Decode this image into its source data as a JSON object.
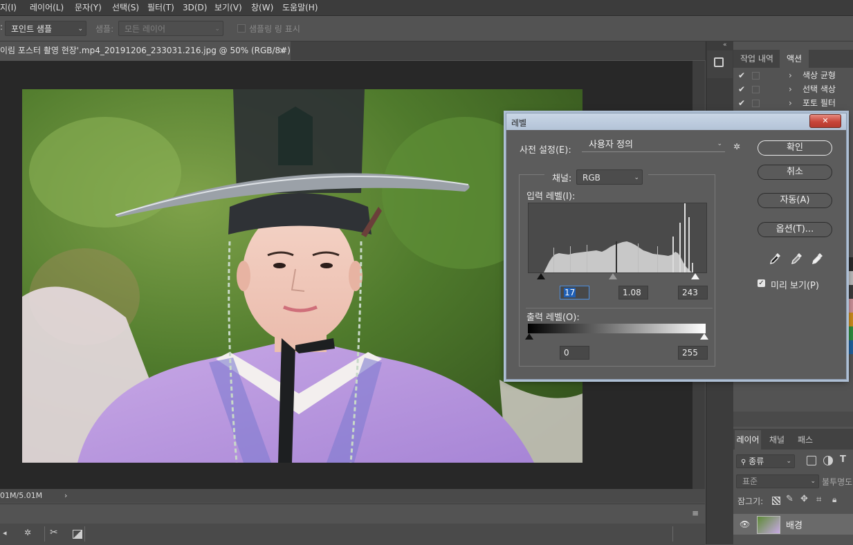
{
  "menu": [
    "지(I)",
    "레이어(L)",
    "문자(Y)",
    "선택(S)",
    "필터(T)",
    "3D(D)",
    "보기(V)",
    "창(W)",
    "도움말(H)"
  ],
  "options": {
    "sample_select": "포인트 샘플",
    "sample_label": "샘플:",
    "layer_select": "모든 레이어",
    "ring_label": "샘플링 링 표시"
  },
  "document": {
    "tab_title": "이림 포스터 촬영 현장'.mp4_20191206_233031.216.jpg @ 50% (RGB/8#)",
    "close": "×",
    "status": "01M/5.01M",
    "status_arrow": "›"
  },
  "history_panel": {
    "tabs": [
      "작업 내역",
      "액션"
    ],
    "actions": [
      "색상 균형",
      "선택 색상",
      "포토 필터"
    ]
  },
  "layers_panel": {
    "tabs": [
      "레이어",
      "채널",
      "패스"
    ],
    "filter_label": "종류",
    "blend_mode": "표준",
    "opacity_label": "불투명도",
    "lock_label": "잠그기:",
    "layer_name": "배경"
  },
  "levels_dialog": {
    "title": "레벨",
    "close": "✕",
    "preset_label": "사전 설정(E):",
    "preset_value": "사용자 정의",
    "channel_label": "채널:",
    "channel_value": "RGB",
    "input_label": "입력 레벨(I):",
    "input_black": "17",
    "input_gamma": "1.08",
    "input_white": "243",
    "output_label": "출력 레벨(O):",
    "output_black": "0",
    "output_white": "255",
    "buttons": {
      "ok": "확인",
      "cancel": "취소",
      "auto": "자동(A)",
      "options": "옵션(T)..."
    },
    "preview_label": "미리 보기(P)",
    "preview_checked": true
  },
  "colors": {
    "accent_blue": "#1f5fb5",
    "title_bar": "#c9d6e6",
    "close_red": "#c8453a"
  }
}
